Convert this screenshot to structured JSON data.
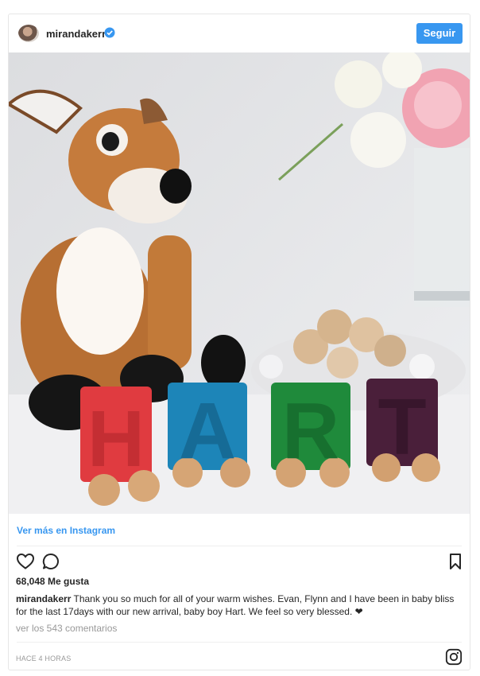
{
  "post": {
    "username": "mirandakerr",
    "follow_label": "Seguir",
    "photo_letters": [
      "H",
      "A",
      "R",
      "T"
    ],
    "view_more_label": "Ver más en Instagram",
    "likes": "68,048 Me gusta",
    "caption_user": "mirandakerr",
    "caption_text": "Thank you so much for all of your warm wishes. Evan, Flynn and I have been in baby bliss for the last 17days with our new arrival, baby boy Hart. We feel so very blessed. ❤",
    "comments_label": "ver los 543 comentarios",
    "timestamp": "HACE 4 HORAS"
  },
  "icons": {
    "verified": "verified-badge-icon",
    "like": "heart-icon",
    "comment": "comment-icon",
    "save": "bookmark-icon",
    "instagram": "instagram-logo-icon"
  },
  "colors": {
    "accent": "#3897f0",
    "text": "#262626",
    "muted": "#999999"
  }
}
